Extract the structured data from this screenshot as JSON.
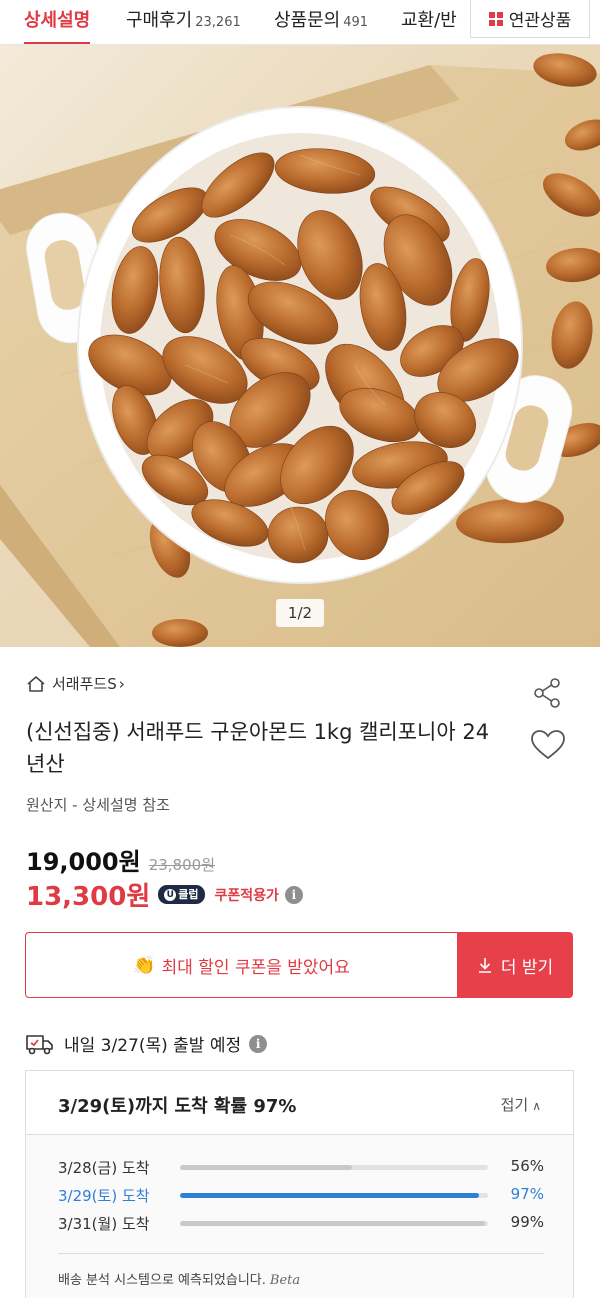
{
  "tabs": [
    {
      "label": "상세설명",
      "count": ""
    },
    {
      "label": "구매후기",
      "count": "23,261"
    },
    {
      "label": "상품문의",
      "count": "491"
    },
    {
      "label": "교환/반",
      "count": ""
    }
  ],
  "related_label": "연관상품",
  "image_counter": "1/2",
  "seller": "서래푸드S",
  "title": "(신선집중) 서래푸드 구운아몬드 1kg 캘리포니아 24년산",
  "origin": "원산지 - 상세설명 참조",
  "price": "19,000원",
  "original_price": "23,800원",
  "coupon_price": "13,300원",
  "club_badge": "클럽",
  "club_badge_u": "U",
  "coupon_label": "쿠폰적용가",
  "coupon_button": "최대 할인 쿠폰을 받았어요",
  "more_button": "더 받기",
  "shipping": "내일 3/27(목) 출발 예정",
  "delivery": {
    "title": "3/29(토)까지 도착 확률 97%",
    "fold_label": "접기",
    "rows": [
      {
        "label": "3/28(금) 도착",
        "pct": "56%",
        "value": 56
      },
      {
        "label": "3/29(토) 도착",
        "pct": "97%",
        "value": 97
      },
      {
        "label": "3/31(월) 도착",
        "pct": "99%",
        "value": 99
      }
    ],
    "note": "배송 분석 시스템으로 예측되었습니다.",
    "beta": "Beta"
  },
  "colors": {
    "accent": "#e03a44",
    "highlight": "#2e7fd6"
  }
}
